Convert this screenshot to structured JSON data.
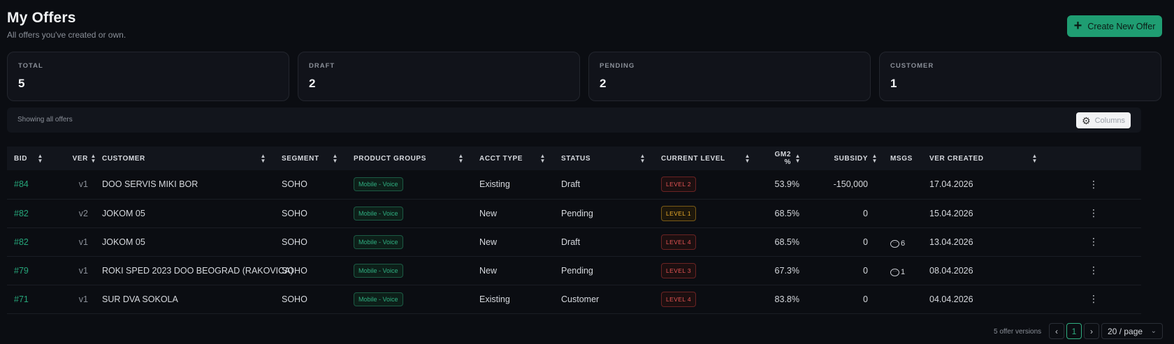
{
  "header": {
    "title": "My Offers",
    "subtitle": "All offers you've created or own.",
    "create_label": "Create New Offer"
  },
  "stats": [
    {
      "label": "TOTAL",
      "value": "5"
    },
    {
      "label": "DRAFT",
      "value": "2"
    },
    {
      "label": "PENDING",
      "value": "2"
    },
    {
      "label": "CUSTOMER",
      "value": "1"
    }
  ],
  "filter": {
    "text": "Showing all offers",
    "columns_label": "Columns"
  },
  "table": {
    "headers": {
      "bid": "BID",
      "ver": "VER",
      "customer": "CUSTOMER",
      "segment": "SEGMENT",
      "product_groups": "PRODUCT GROUPS",
      "acct_type": "ACCT TYPE",
      "status": "STATUS",
      "current_level": "CURRENT LEVEL",
      "gm2": "GM2 %",
      "subsidy": "SUBSIDY",
      "msgs": "MSGS",
      "ver_created": "VER CREATED"
    },
    "rows": [
      {
        "bid": "#84",
        "ver": "v1",
        "customer": "DOO SERVIS MIKI BOR",
        "segment": "SOHO",
        "product": "Mobile - Voice",
        "acct_type": "Existing",
        "status": "Draft",
        "level": "LEVEL 2",
        "gm2": "53.9%",
        "subsidy": "-150,000",
        "msgs": "",
        "created": "17.04.2026"
      },
      {
        "bid": "#82",
        "ver": "v2",
        "customer": "JOKOM 05",
        "segment": "SOHO",
        "product": "Mobile - Voice",
        "acct_type": "New",
        "status": "Pending",
        "level": "LEVEL 1",
        "gm2": "68.5%",
        "subsidy": "0",
        "msgs": "",
        "created": "15.04.2026"
      },
      {
        "bid": "#82",
        "ver": "v1",
        "customer": "JOKOM 05",
        "segment": "SOHO",
        "product": "Mobile - Voice",
        "acct_type": "New",
        "status": "Draft",
        "level": "LEVEL 4",
        "gm2": "68.5%",
        "subsidy": "0",
        "msgs": "6",
        "created": "13.04.2026"
      },
      {
        "bid": "#79",
        "ver": "v1",
        "customer": "ROKI SPED 2023 DOO BEOGRAD (RAKOVICA)",
        "segment": "SOHO",
        "product": "Mobile - Voice",
        "acct_type": "New",
        "status": "Pending",
        "level": "LEVEL 3",
        "gm2": "67.3%",
        "subsidy": "0",
        "msgs": "1",
        "created": "08.04.2026"
      },
      {
        "bid": "#71",
        "ver": "v1",
        "customer": "SUR DVA SOKOLA",
        "segment": "SOHO",
        "product": "Mobile - Voice",
        "acct_type": "Existing",
        "status": "Customer",
        "level": "LEVEL 4",
        "gm2": "83.8%",
        "subsidy": "0",
        "msgs": "",
        "created": "04.04.2026"
      }
    ]
  },
  "pagination": {
    "count_text": "5 offer versions",
    "current_page": "1",
    "page_size": "20 / page"
  },
  "colors": {
    "accent": "#1f9d72",
    "level_red": "#e25353",
    "level_amber": "#e6a82a"
  }
}
